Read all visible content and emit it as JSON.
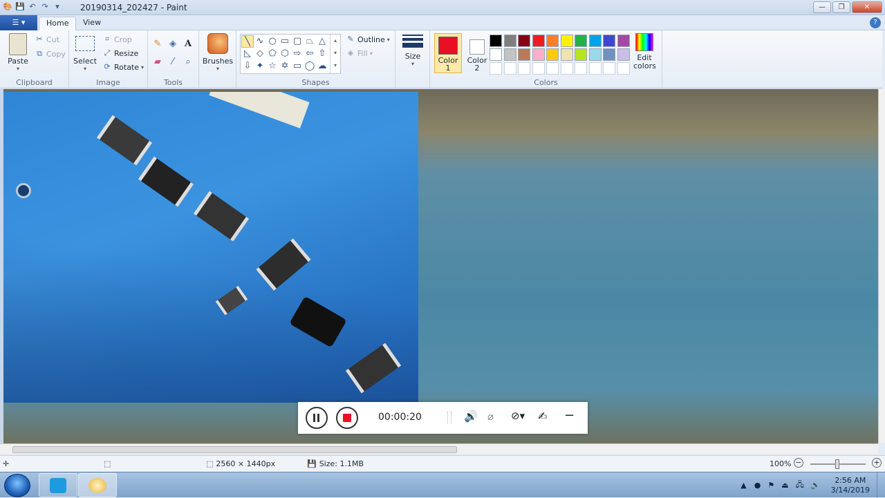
{
  "window": {
    "title": "20190314_202427 - Paint",
    "controls": [
      "—",
      "❐",
      "✕"
    ]
  },
  "tabs": {
    "file": "☰ ▾",
    "home": "Home",
    "view": "View",
    "help": "?"
  },
  "ribbon": {
    "clipboard": {
      "paste": "Paste",
      "cut": "Cut",
      "copy": "Copy",
      "label": "Clipboard"
    },
    "image": {
      "select": "Select",
      "crop": "Crop",
      "resize": "Resize",
      "rotate": "Rotate",
      "label": "Image"
    },
    "tools": {
      "label": "Tools"
    },
    "brushes": {
      "label": "Brushes"
    },
    "shapes": {
      "outline": "Outline",
      "fill": "Fill",
      "label": "Shapes"
    },
    "size": {
      "label": "Size"
    },
    "colors": {
      "color1": "Color 1",
      "color2": "Color 2",
      "edit": "Edit colors",
      "label": "Colors",
      "color1_value": "#e81123",
      "color2_value": "#ffffff",
      "palette_row1": [
        "#000000",
        "#7f7f7f",
        "#880015",
        "#ed1c24",
        "#ff7f27",
        "#fff200",
        "#22b14c",
        "#00a2e8",
        "#3f48cc",
        "#a349a4"
      ],
      "palette_row2": [
        "#ffffff",
        "#c3c3c3",
        "#b97a57",
        "#ffaec9",
        "#ffc90e",
        "#efe4b0",
        "#b5e61d",
        "#99d9ea",
        "#7092be",
        "#c8bfe7"
      ]
    }
  },
  "recorder": {
    "time": "00:00:20"
  },
  "status": {
    "dimensions": "2560 × 1440px",
    "size": "Size: 1.1MB",
    "zoom": "100%"
  },
  "taskbar": {
    "time": "2:56 AM",
    "date": "3/14/2019"
  },
  "icons": {
    "save": "save-icon",
    "undo": "undo-icon",
    "redo": "redo-icon",
    "pencil": "pencil-icon",
    "fill": "fill-bucket-icon",
    "text": "text-icon",
    "eraser": "eraser-icon",
    "picker": "color-picker-icon",
    "magnifier": "magnifier-icon"
  }
}
